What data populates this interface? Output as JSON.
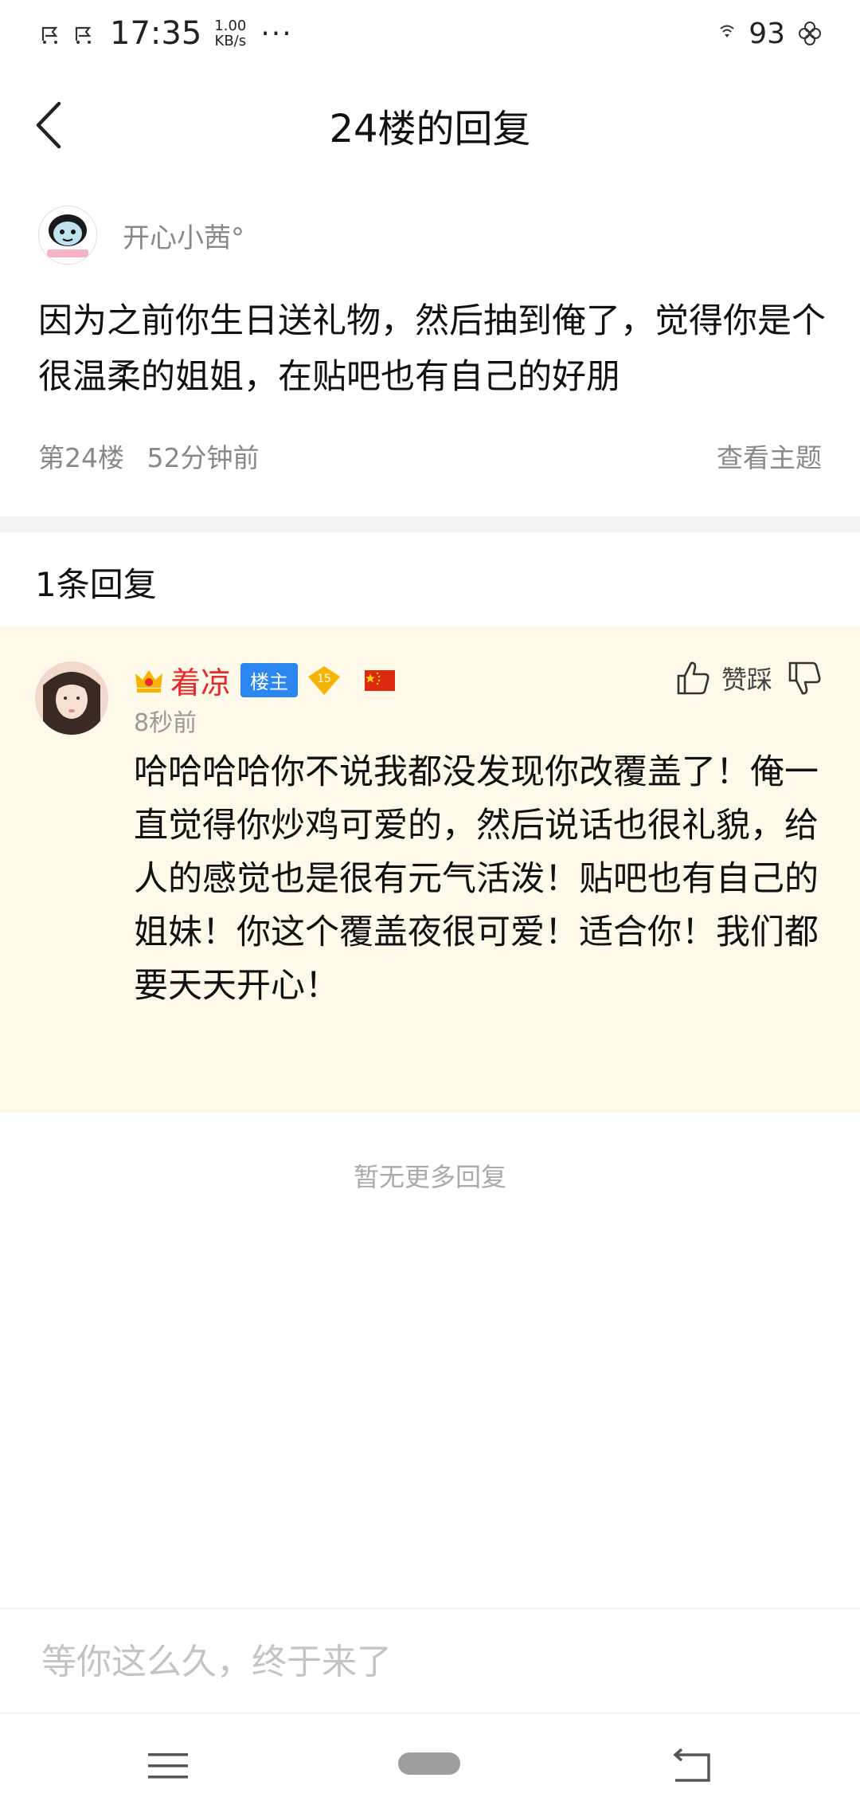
{
  "status_bar": {
    "time": "17:35",
    "network_speed_value": "1.00",
    "network_speed_unit": "KB/s",
    "more_indicator": "···",
    "battery": "93",
    "icons": [
      "notification-icon",
      "notification-icon",
      "wifi-icon",
      "flower-icon"
    ]
  },
  "header": {
    "title": "24楼的回复",
    "back_icon": "chevron-left-icon"
  },
  "main_post": {
    "author": "开心小茜°",
    "content": "因为之前你生日送礼物，然后抽到俺了，觉得你是个很温柔的姐姐，在贴吧也有自己的好朋",
    "floor": "第24楼",
    "time": "52分钟前",
    "view_topic": "查看主题"
  },
  "replies": {
    "count_label": "1条回复",
    "items": [
      {
        "name": "着凉",
        "badge": "楼主",
        "level": "15",
        "time": "8秒前",
        "like_label": "赞踩",
        "content": "哈哈哈哈你不说我都没发现你改覆盖了！俺一直觉得你炒鸡可爱的，然后说话也很礼貌，给人的感觉也是很有元气活泼！贴吧也有自己的姐妹！你这个覆盖夜很可爱！适合你！我们都要天天开心！"
      }
    ],
    "no_more": "暂无更多回复"
  },
  "input": {
    "placeholder": "等你这么久，终于来了"
  },
  "colors": {
    "reply_bg": "#fef9e9",
    "username_red": "#e8292b",
    "badge_blue": "#2b86f0",
    "level_gold": "#f6b400",
    "muted_text": "#888888"
  }
}
